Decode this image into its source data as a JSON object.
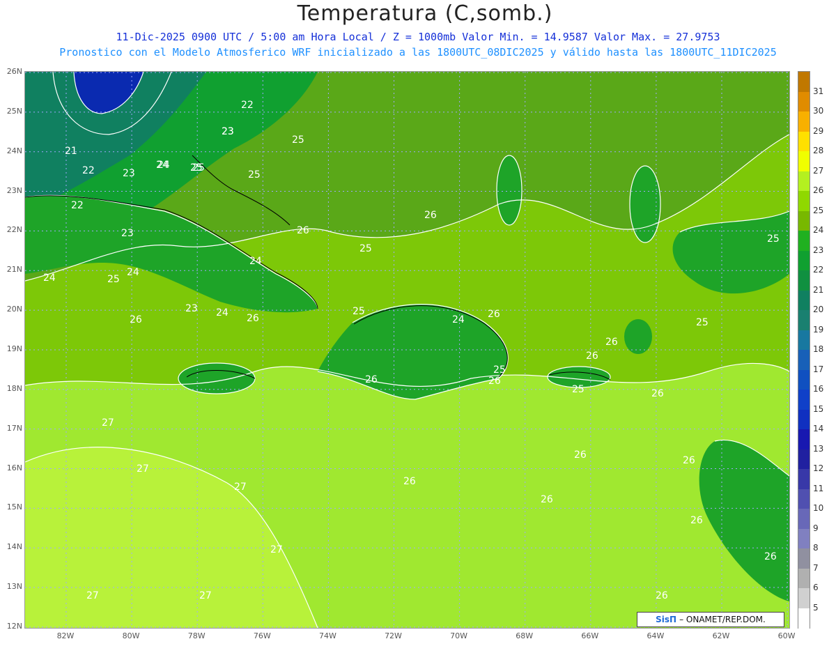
{
  "title": "Temperatura (C,somb.)",
  "subtitle": "11-Dic-2025  0900 UTC / 5:00 am Hora Local / Z = 1000mb   Valor Min. = 14.9587  Valor Max. = 27.9753",
  "subtitle2": "Pronostico con el Modelo Atmosferico WRF inicializado a las 1800UTC_08DIC2025 y válido hasta las  1800UTC_11DIC2025",
  "credit": {
    "brand": "SisΠ",
    "text": "– ONAMET/REP.DOM."
  },
  "y_ticks": [
    "26N",
    "25N",
    "24N",
    "23N",
    "22N",
    "21N",
    "20N",
    "19N",
    "18N",
    "17N",
    "16N",
    "15N",
    "14N",
    "13N",
    "12N"
  ],
  "x_ticks": [
    "82W",
    "80W",
    "78W",
    "76W",
    "74W",
    "72W",
    "70W",
    "68W",
    "66W",
    "64W",
    "62W",
    "60W"
  ],
  "colorbar": {
    "levels": [
      "31",
      "30",
      "29",
      "28",
      "27",
      "26",
      "25",
      "24",
      "23",
      "22",
      "21",
      "20",
      "19",
      "18",
      "17",
      "16",
      "15",
      "14",
      "13",
      "12",
      "11",
      "10",
      "9",
      "8",
      "7",
      "6",
      "5"
    ],
    "colors": [
      "#c07800",
      "#e08c00",
      "#f8b000",
      "#ffe000",
      "#f0ff00",
      "#b4f020",
      "#90d800",
      "#78b800",
      "#20b020",
      "#10a030",
      "#109040",
      "#108060",
      "#1a8070",
      "#1878a0",
      "#1860b8",
      "#1050c0",
      "#1040c8",
      "#1030c0",
      "#1818b0",
      "#2020a0",
      "#3838a8",
      "#5050b0",
      "#6868b8",
      "#8080c0",
      "#9090a0",
      "#b0b0b0",
      "#d0d0d0",
      "#ffffff"
    ]
  },
  "contour_labels": [
    "25",
    "22",
    "23",
    "25",
    "24",
    "23",
    "25",
    "21",
    "22",
    "23",
    "22",
    "23",
    "24",
    "25",
    "24",
    "24",
    "26",
    "26",
    "25",
    "24",
    "25",
    "26",
    "26",
    "24",
    "23",
    "24",
    "26",
    "25",
    "26",
    "26",
    "25",
    "26",
    "25",
    "26",
    "26",
    "26",
    "25",
    "27",
    "27",
    "27",
    "27",
    "26",
    "26",
    "26",
    "26",
    "26",
    "26",
    "25",
    "27",
    "27"
  ],
  "colors": {
    "sea_light": "#a0e830",
    "sea_mid": "#7dc808",
    "land": "#5aa818",
    "dark_green": "#1ea428",
    "teal": "#10866a",
    "deep_blue": "#0a2ab0",
    "grid": "#a0a8ff",
    "contour": "#ffffff",
    "coast": "#000000"
  }
}
